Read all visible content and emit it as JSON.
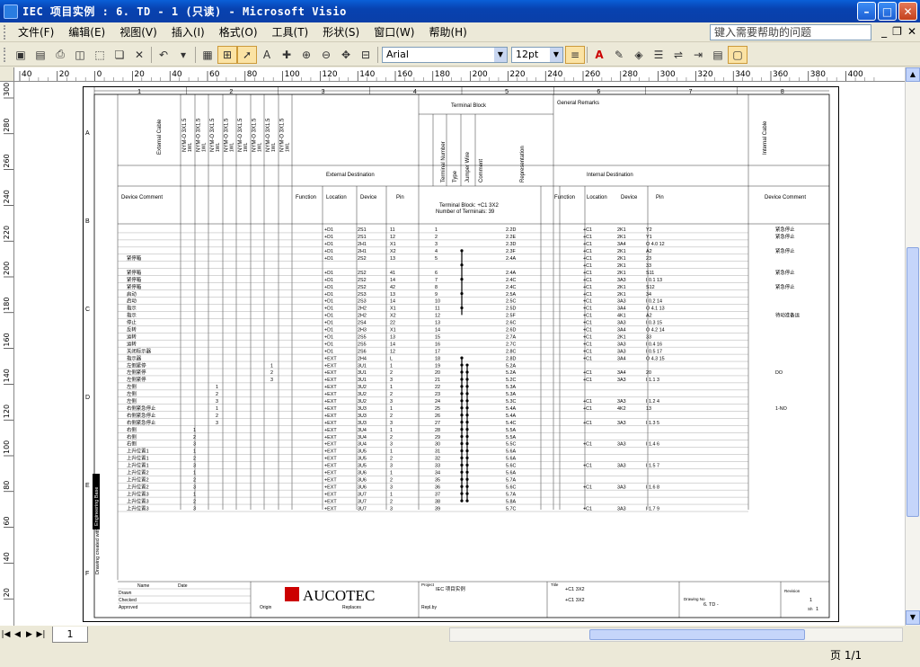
{
  "window": {
    "title": "IEC 项目实例 : 6. TD - 1 (只读) - Microsoft Visio"
  },
  "menus": [
    "文件(F)",
    "编辑(E)",
    "视图(V)",
    "插入(I)",
    "格式(O)",
    "工具(T)",
    "形状(S)",
    "窗口(W)",
    "帮助(H)"
  ],
  "help": {
    "placeholder": "键入需要帮助的问题"
  },
  "toolbar": {
    "font": "Arial",
    "size": "12pt"
  },
  "ruler_h": [
    "40",
    "20",
    "0",
    "20",
    "40",
    "60",
    "80",
    "100",
    "120",
    "140",
    "160",
    "180",
    "200",
    "220",
    "240",
    "260",
    "280",
    "300",
    "320",
    "340",
    "360",
    "380",
    "400"
  ],
  "ruler_v": [
    "300",
    "280",
    "260",
    "240",
    "220",
    "200",
    "180",
    "160",
    "140",
    "120",
    "100",
    "80",
    "60",
    "40",
    "20",
    "0"
  ],
  "drawing": {
    "col_numbers": [
      "1",
      "2",
      "3",
      "4",
      "5",
      "6",
      "7",
      "8"
    ],
    "row_letters": [
      "A",
      "B",
      "C",
      "D",
      "E",
      "F"
    ],
    "headers": {
      "terminal_block": "Terminal Block",
      "general_remarks": "General Remarks",
      "external_cable": "External Cable",
      "internal_cable": "Internal Cable",
      "external_destination": "External Destination",
      "internal_destination": "Internal Destination",
      "terminal_number": "Terminal Number",
      "type": "Type",
      "jumper_wire": "Jumper Wire",
      "comment": "Comment",
      "representation": "Representation",
      "device_comment": "Device Comment",
      "function": "Function",
      "location": "Location",
      "device": "Device",
      "pin": "Pin",
      "tb_label": "Terminal Block: +C1 3X2",
      "tb_count": "Number of Terminals: 39",
      "cable_name": "NYM-O 3X1.5",
      "cable_sub": "1WL"
    },
    "rows": [
      [
        "",
        "",
        "",
        "",
        "+D1",
        "2S1",
        "11",
        "1",
        "2.2D",
        "",
        "+C1",
        "2K1",
        "Y2",
        "紧急停止"
      ],
      [
        "",
        "",
        "",
        "",
        "+D1",
        "2S1",
        "12",
        "2",
        "2.2E",
        "",
        "+C1",
        "2K1",
        "Y1",
        "紧急停止"
      ],
      [
        "",
        "",
        "",
        "",
        "+D1",
        "2H1",
        "X1",
        "3",
        "2.3D",
        "",
        "+C1",
        "3A4",
        "O 4.0 12",
        ""
      ],
      [
        "",
        "",
        "",
        "",
        "+D1",
        "2H1",
        "X2",
        "4",
        "2.3F",
        "",
        "+C1",
        "2K1",
        "A2",
        "紧急停止"
      ],
      [
        "紧停箱",
        "",
        "",
        "",
        "+D1",
        "2S2",
        "13",
        "5",
        "2.4A",
        "",
        "+C1",
        "2K1",
        "23",
        ""
      ],
      [
        "",
        "",
        "",
        "",
        "",
        "",
        "",
        "",
        "",
        "",
        "+C1",
        "2K1",
        "33",
        ""
      ],
      [
        "紧停箱",
        "",
        "",
        "",
        "+D1",
        "2S2",
        "41",
        "6",
        "2.4A",
        "",
        "+C1",
        "2K1",
        "S11",
        "紧急停止"
      ],
      [
        "紧停箱",
        "",
        "",
        "",
        "+D1",
        "2S2",
        "14",
        "7",
        "2.4C",
        "",
        "+C1",
        "3A3",
        "I 0.1 13",
        ""
      ],
      [
        "紧停箱",
        "",
        "",
        "",
        "+D1",
        "2S2",
        "42",
        "8",
        "2.4C",
        "",
        "+C1",
        "2K1",
        "S12",
        "紧急停止"
      ],
      [
        "启动",
        "",
        "",
        "",
        "+D1",
        "2S3",
        "13",
        "9",
        "2.5A",
        "",
        "+C1",
        "2K1",
        "34",
        ""
      ],
      [
        "启动",
        "",
        "",
        "",
        "+D1",
        "2S3",
        "14",
        "10",
        "2.5C",
        "",
        "+C1",
        "3A3",
        "I 0.2 14",
        ""
      ],
      [
        "指示",
        "",
        "",
        "",
        "+D1",
        "2H2",
        "X1",
        "11",
        "2.5D",
        "",
        "+C1",
        "3A4",
        "O 4.1 13",
        ""
      ],
      [
        "指示",
        "",
        "",
        "",
        "+D1",
        "2H2",
        "X2",
        "12",
        "2.5F",
        "",
        "+C1",
        "4K1",
        "A2",
        "待动准备运"
      ],
      [
        "停止",
        "",
        "",
        "",
        "+D1",
        "2S4",
        "22",
        "13",
        "2.6C",
        "",
        "+C1",
        "3A3",
        "I 0.3 15",
        ""
      ],
      [
        "反转",
        "",
        "",
        "",
        "+D1",
        "2H3",
        "X1",
        "14",
        "2.6D",
        "",
        "+C1",
        "3A4",
        "O 4.2 14",
        ""
      ],
      [
        "运转",
        "",
        "",
        "",
        "+D1",
        "2S5",
        "13",
        "15",
        "2.7A",
        "",
        "+C1",
        "2K1",
        "33",
        ""
      ],
      [
        "运转",
        "",
        "",
        "",
        "+D1",
        "2S5",
        "14",
        "16",
        "2.7C",
        "",
        "+C1",
        "3A3",
        "I 0.4 16",
        ""
      ],
      [
        "关闭标示器",
        "",
        "",
        "",
        "+D1",
        "2S6",
        "12",
        "17",
        "2.8C",
        "",
        "+C1",
        "3A3",
        "I 0.5 17",
        ""
      ],
      [
        "指示器",
        "",
        "",
        "",
        "+EXT",
        "2H4",
        "L",
        "18",
        "2.8D",
        "",
        "+C1",
        "3A4",
        "O 4.3 15",
        ""
      ],
      [
        "左侧紧停",
        "",
        "",
        "1",
        "+EXT",
        "3U1",
        "1",
        "19",
        "5.2A",
        "",
        "",
        "",
        "",
        ""
      ],
      [
        "左侧紧停",
        "",
        "",
        "2",
        "+EXT",
        "3U1",
        "2",
        "20",
        "5.2A",
        "",
        "+C1",
        "3A4",
        "20",
        "DO"
      ],
      [
        "左侧紧停",
        "",
        "",
        "3",
        "+EXT",
        "3U1",
        "3",
        "21",
        "5.2C",
        "",
        "+C1",
        "3A3",
        "I 1.1 3",
        ""
      ],
      [
        "左侧",
        "",
        "1",
        "",
        "+EXT",
        "3U2",
        "1",
        "22",
        "5.3A",
        "",
        "",
        "",
        "",
        ""
      ],
      [
        "左侧",
        "",
        "2",
        "",
        "+EXT",
        "3U2",
        "2",
        "23",
        "5.3A",
        "",
        "",
        "",
        "",
        ""
      ],
      [
        "左侧",
        "",
        "3",
        "",
        "+EXT",
        "3U2",
        "3",
        "24",
        "5.3C",
        "",
        "+C1",
        "3A3",
        "I 1.2 4",
        ""
      ],
      [
        "右侧紧急停止",
        "",
        "1",
        "",
        "+EXT",
        "3U3",
        "1",
        "25",
        "5.4A",
        "",
        "+C1",
        "4K2",
        "13",
        "1-NO"
      ],
      [
        "右侧紧急停止",
        "",
        "2",
        "",
        "+EXT",
        "3U3",
        "2",
        "26",
        "5.4A",
        "",
        "",
        "",
        "",
        ""
      ],
      [
        "右侧紧急停止",
        "",
        "3",
        "",
        "+EXT",
        "3U3",
        "3",
        "27",
        "5.4C",
        "",
        "+C1",
        "3A3",
        "I 1.3 5",
        ""
      ],
      [
        "右侧",
        "1",
        "",
        "",
        "+EXT",
        "3U4",
        "1",
        "28",
        "5.5A",
        "",
        "",
        "",
        "",
        ""
      ],
      [
        "右侧",
        "2",
        "",
        "",
        "+EXT",
        "3U4",
        "2",
        "29",
        "5.5A",
        "",
        "",
        "",
        "",
        ""
      ],
      [
        "右侧",
        "3",
        "",
        "",
        "+EXT",
        "3U4",
        "3",
        "30",
        "5.5C",
        "",
        "+C1",
        "3A3",
        "I 1.4 6",
        ""
      ],
      [
        "上升位置1",
        "1",
        "",
        "",
        "+EXT",
        "3U5",
        "1",
        "31",
        "5.6A",
        "",
        "",
        "",
        "",
        ""
      ],
      [
        "上升位置1",
        "2",
        "",
        "",
        "+EXT",
        "3U5",
        "2",
        "32",
        "5.6A",
        "",
        "",
        "",
        "",
        ""
      ],
      [
        "上升位置1",
        "3",
        "",
        "",
        "+EXT",
        "3U5",
        "3",
        "33",
        "5.6C",
        "",
        "+C1",
        "3A3",
        "I 1.5 7",
        ""
      ],
      [
        "上升位置2",
        "1",
        "",
        "",
        "+EXT",
        "3U6",
        "1",
        "34",
        "5.6A",
        "",
        "",
        "",
        "",
        ""
      ],
      [
        "上升位置2",
        "2",
        "",
        "",
        "+EXT",
        "3U6",
        "2",
        "35",
        "5.7A",
        "",
        "",
        "",
        "",
        ""
      ],
      [
        "上升位置2",
        "3",
        "",
        "",
        "+EXT",
        "3U6",
        "3",
        "36",
        "5.6C",
        "",
        "+C1",
        "3A3",
        "I 1.6 8",
        ""
      ],
      [
        "上升位置3",
        "1",
        "",
        "",
        "+EXT",
        "3U7",
        "1",
        "37",
        "5.7A",
        "",
        "",
        "",
        "",
        ""
      ],
      [
        "上升位置3",
        "2",
        "",
        "",
        "+EXT",
        "3U7",
        "2",
        "38",
        "5.8A",
        "",
        "",
        "",
        "",
        ""
      ],
      [
        "上升位置3",
        "3",
        "",
        "",
        "+EXT",
        "3U7",
        "3",
        "39",
        "5.7C",
        "",
        "+C1",
        "3A3",
        "I 1.7 9",
        ""
      ]
    ],
    "titleblock": {
      "name": "Name",
      "date": "Date",
      "drawn": "Drawn",
      "checked": "Checked",
      "approved": "Approved",
      "origin": "Origin",
      "replaces": "Replaces",
      "replaced_by": "Repl.by",
      "logo": "AUCOTEC",
      "project_label": "Project",
      "project": "IEC 项目实例",
      "title_label": "Title",
      "title1": "+C1 3X2",
      "title2": "+C1 3X2",
      "drawing_no_label": "Drawing No",
      "drawing_no": "6. TD -",
      "revision_label": "Revision",
      "revision": "1",
      "sheet_label": "Sh",
      "sheet": "1",
      "side_text1": "Drawing created with",
      "side_text2": "Engineering Base"
    }
  },
  "status": {
    "tab": "1",
    "page": "页 1/1"
  }
}
